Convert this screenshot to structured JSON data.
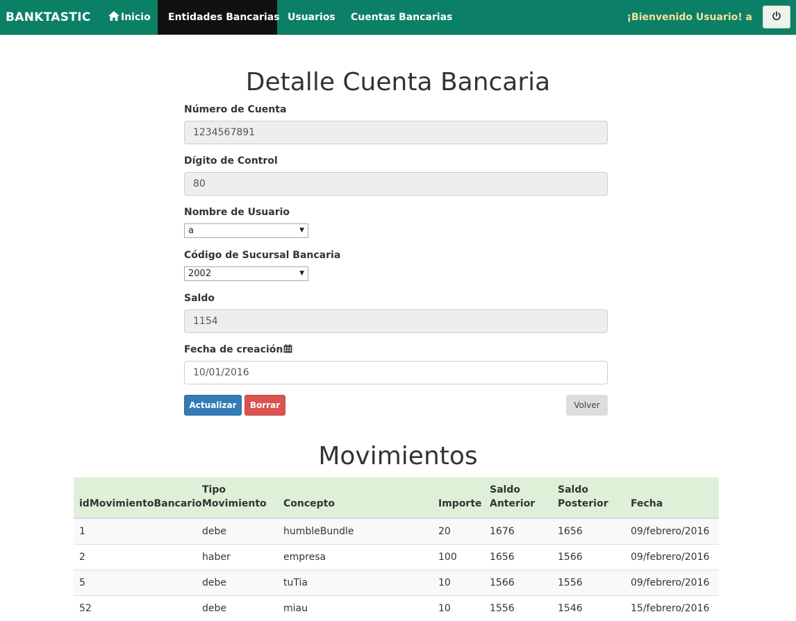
{
  "navbar": {
    "brand": "BANKTASTIC",
    "items": [
      {
        "label": "Inicio",
        "icon": "home-icon"
      },
      {
        "label": "Entidades Bancarias"
      },
      {
        "label": "Usuarios"
      },
      {
        "label": "Cuentas Bancarias"
      }
    ],
    "active_index": 1,
    "welcome": "¡Bienvenido Usuario! a",
    "power_icon": "power-icon"
  },
  "form": {
    "title": "Detalle Cuenta Bancaria",
    "numero_cuenta": {
      "label": "Número de Cuenta",
      "value": "1234567891"
    },
    "digito_control": {
      "label": "Dígito de Control",
      "value": "80"
    },
    "nombre_usuario": {
      "label": "Nombre de Usuario",
      "value": "a"
    },
    "codigo_sucursal": {
      "label": "Código de Sucursal Bancaria",
      "value": "2002"
    },
    "saldo": {
      "label": "Saldo",
      "value": "1154"
    },
    "fecha_creacion": {
      "label": "Fecha de creación",
      "value": "10/01/2016",
      "icon": "calendar-icon"
    },
    "buttons": {
      "update": "Actualizar",
      "delete": "Borrar",
      "back": "Volver"
    }
  },
  "movimientos": {
    "title": "Movimientos",
    "headers": {
      "id": "idMovimientoBancario",
      "tipo_1": "Tipo",
      "tipo_2": "Movimiento",
      "concepto": "Concepto",
      "importe": "Importe",
      "anterior_1": "Saldo",
      "anterior_2": "Anterior",
      "posterior_1": "Saldo",
      "posterior_2": "Posterior",
      "fecha": "Fecha"
    },
    "rows": [
      [
        "1",
        "debe",
        "humbleBundle",
        "20",
        "1676",
        "1656",
        "09/febrero/2016"
      ],
      [
        "2",
        "haber",
        "empresa",
        "100",
        "1656",
        "1566",
        "09/febrero/2016"
      ],
      [
        "5",
        "debe",
        "tuTia",
        "10",
        "1566",
        "1556",
        "09/febrero/2016"
      ],
      [
        "52",
        "debe",
        "miau",
        "10",
        "1556",
        "1546",
        "15/febrero/2016"
      ]
    ]
  },
  "colors": {
    "navbar": "#0c8066",
    "active_nav": "#111111",
    "welcome_text": "#f3e29a",
    "primary": "#337ab7",
    "danger": "#d9534f",
    "table_header": "#dff0d8"
  }
}
